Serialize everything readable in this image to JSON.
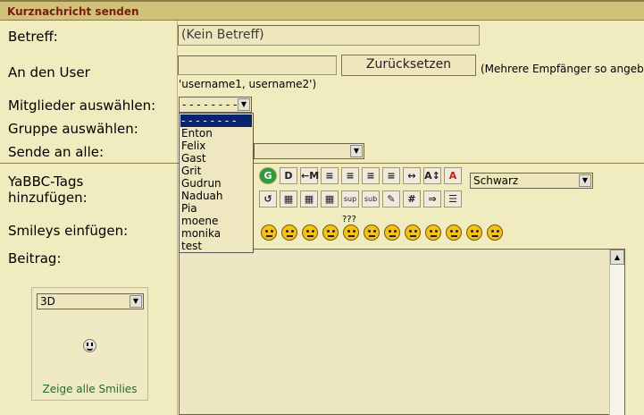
{
  "title": "Kurznachricht senden",
  "labels": {
    "subject": "Betreff:",
    "to_user": "An den User",
    "select_members": "Mitglieder auswählen:",
    "select_group": "Gruppe auswählen:",
    "send_all": "Sende an alle:",
    "yabbc_line1": "YaBBC-Tags",
    "yabbc_line2": "hinzufügen:",
    "smileys": "Smileys einfügen:",
    "post": "Beitrag:"
  },
  "subject_value": "(Kein Betreff)",
  "to_user": {
    "value": "",
    "reset_label": "Zurücksetzen",
    "hint": "(Mehrere Empfänger so angeben:",
    "example": "'username1, username2')"
  },
  "members_select": {
    "selected": "- - - - - - - -",
    "options": [
      "- - - - - - - -",
      "Enton",
      "Felix",
      "Gast",
      "Grit",
      "Gudrun",
      "Naduah",
      "Pia",
      "moene",
      "monika",
      "test"
    ]
  },
  "color_select": {
    "selected": "Schwarz"
  },
  "toolbar_row1": [
    "G",
    "D",
    "←M",
    "≡",
    "≡",
    "≡",
    "≡",
    "↔",
    "A↕",
    "A"
  ],
  "toolbar_row2": [
    "↺",
    "▦",
    "▦",
    "▦",
    "sup",
    "sub",
    "✎",
    "#",
    "⇒",
    "☰"
  ],
  "question_marks": "???",
  "smileys": [
    "happy",
    "angry",
    "shocked",
    "cool",
    "huh",
    "rolleyes",
    "tongue",
    "embarrassed",
    "lipsrsealed",
    "undecided",
    "kiss",
    "cry"
  ],
  "smilie_box": {
    "select_value": "3D",
    "show_all_link": "Zeige alle Smilies"
  }
}
